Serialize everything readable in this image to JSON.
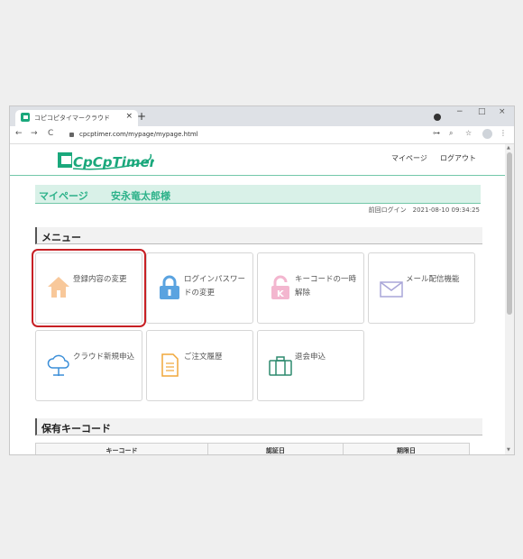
{
  "browser": {
    "tab_title": "コピコピタイマークラウド",
    "tab_close": "×",
    "new_tab": "+",
    "window_controls": {
      "minimize": "−",
      "maximize": "□",
      "close": "×"
    },
    "nav": {
      "back": "←",
      "forward": "→",
      "reload": "C"
    },
    "url": "cpcptimer.com/mypage/mypage.html",
    "right_icons": {
      "key": "⊶",
      "zoom": "⌕",
      "star": "☆",
      "menu": "⋮"
    }
  },
  "header": {
    "logo_text": "CpCpTimer",
    "nav": [
      {
        "label": "マイページ"
      },
      {
        "label": "ログアウト"
      }
    ]
  },
  "userbar": {
    "title": "マイページ",
    "user": "安永竜太郎様"
  },
  "last_login": "前回ログイン　2021-08-10 09:34:25",
  "menu_heading": "メニュー",
  "menu": [
    {
      "label": "登録内容の変更",
      "icon": "house-icon"
    },
    {
      "label": "ログインパスワードの変更",
      "icon": "padlock-icon"
    },
    {
      "label": "キーコードの一時解除",
      "icon": "key-lock-icon"
    },
    {
      "label": "メール配信機能",
      "icon": "envelope-icon"
    },
    {
      "label": "クラウド新規申込",
      "icon": "cloud-icon"
    },
    {
      "label": "ご注文履歴",
      "icon": "document-icon"
    },
    {
      "label": "退会申込",
      "icon": "briefcase-icon"
    }
  ],
  "keycode_heading": "保有キーコード",
  "keycode_table": {
    "headers": [
      "キーコード",
      "認証日",
      "期限日"
    ]
  },
  "colors": {
    "accent": "#2db28a",
    "selection": "#c71f24"
  }
}
